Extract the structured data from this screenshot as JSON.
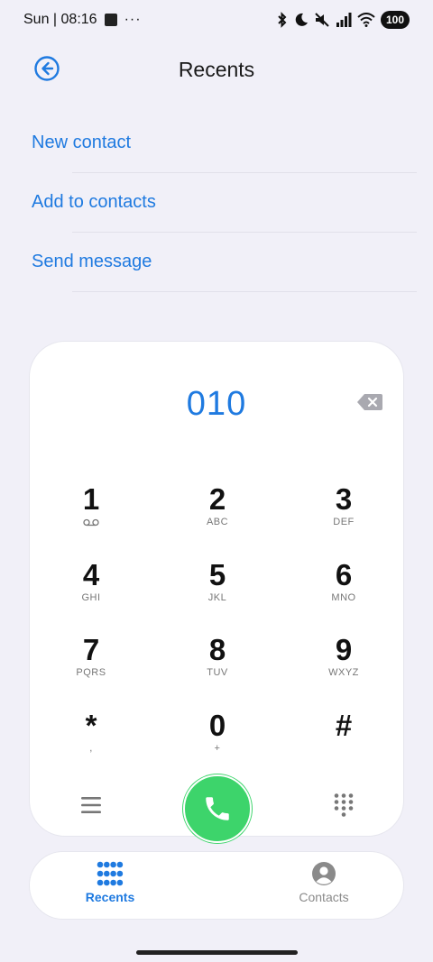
{
  "status_bar": {
    "time": "Sun | 08:16",
    "more": "···",
    "battery": "100"
  },
  "header": {
    "title": "Recents"
  },
  "actions": [
    {
      "label": "New contact"
    },
    {
      "label": "Add to contacts"
    },
    {
      "label": "Send message"
    }
  ],
  "dialer": {
    "number": "010",
    "keys": [
      {
        "digit": "1",
        "letters": ""
      },
      {
        "digit": "2",
        "letters": "ABC"
      },
      {
        "digit": "3",
        "letters": "DEF"
      },
      {
        "digit": "4",
        "letters": "GHI"
      },
      {
        "digit": "5",
        "letters": "JKL"
      },
      {
        "digit": "6",
        "letters": "MNO"
      },
      {
        "digit": "7",
        "letters": "PQRS"
      },
      {
        "digit": "8",
        "letters": "TUV"
      },
      {
        "digit": "9",
        "letters": "WXYZ"
      },
      {
        "digit": "*",
        "letters": ","
      },
      {
        "digit": "0",
        "letters": "+"
      },
      {
        "digit": "#",
        "letters": ""
      }
    ]
  },
  "bottom_nav": {
    "recents_label": "Recents",
    "contacts_label": "Contacts"
  },
  "colors": {
    "accent": "#1f7ae0",
    "call_green": "#3dd46b",
    "background": "#f1f0f8"
  }
}
